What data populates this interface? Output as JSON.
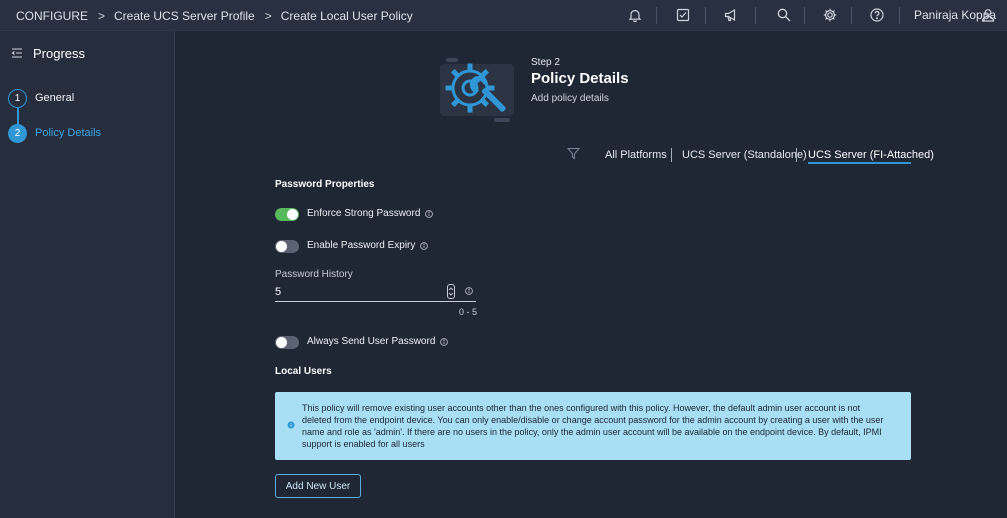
{
  "breadcrumb": {
    "items": [
      "CONFIGURE",
      "Create UCS Server Profile",
      "Create Local User Policy"
    ],
    "separator": ">"
  },
  "header": {
    "icons": [
      "bell-icon",
      "task-check-icon",
      "megaphone-icon",
      "search-icon",
      "gear-icon",
      "help-icon",
      "user-icon"
    ],
    "user_name": "Paniraja Koppa"
  },
  "sidebar": {
    "title": "Progress",
    "steps": [
      {
        "number": "1",
        "label": "General",
        "state": "done"
      },
      {
        "number": "2",
        "label": "Policy Details",
        "state": "active"
      }
    ]
  },
  "main": {
    "step_label": "Step 2",
    "title": "Policy Details",
    "subtitle": "Add policy details",
    "platform_tabs": [
      {
        "label": "All Platforms",
        "active": false
      },
      {
        "label": "UCS Server (Standalone)",
        "active": false
      },
      {
        "label": "UCS Server (FI-Attached)",
        "active": true
      }
    ],
    "password_properties": {
      "section_title": "Password Properties",
      "enforce_strong_password": {
        "label": "Enforce Strong Password",
        "on": true
      },
      "enable_password_expiry": {
        "label": "Enable Password Expiry",
        "on": false
      },
      "password_history": {
        "label": "Password History",
        "value": "5",
        "range": "0 - 5"
      },
      "always_send_user_password": {
        "label": "Always Send User Password",
        "on": false
      }
    },
    "local_users": {
      "section_title": "Local Users",
      "info_message": "This policy will remove existing user accounts other than the ones configured with this policy. However, the default admin user account is not deleted from the endpoint device. You can only enable/disable or change account password for the admin account by creating a user with the user name and role as 'admin'. If there are no users in the policy, only the admin user account will be available on the endpoint device. By default, IPMI support is enabled for all users",
      "add_button": "Add New User"
    }
  },
  "colors": {
    "background": "#1f2634",
    "topbar": "#283041",
    "sidebar": "#262d3c",
    "accent": "#2f97d6",
    "toggle_on": "#58b85c",
    "info_box": "#a9dff5"
  }
}
